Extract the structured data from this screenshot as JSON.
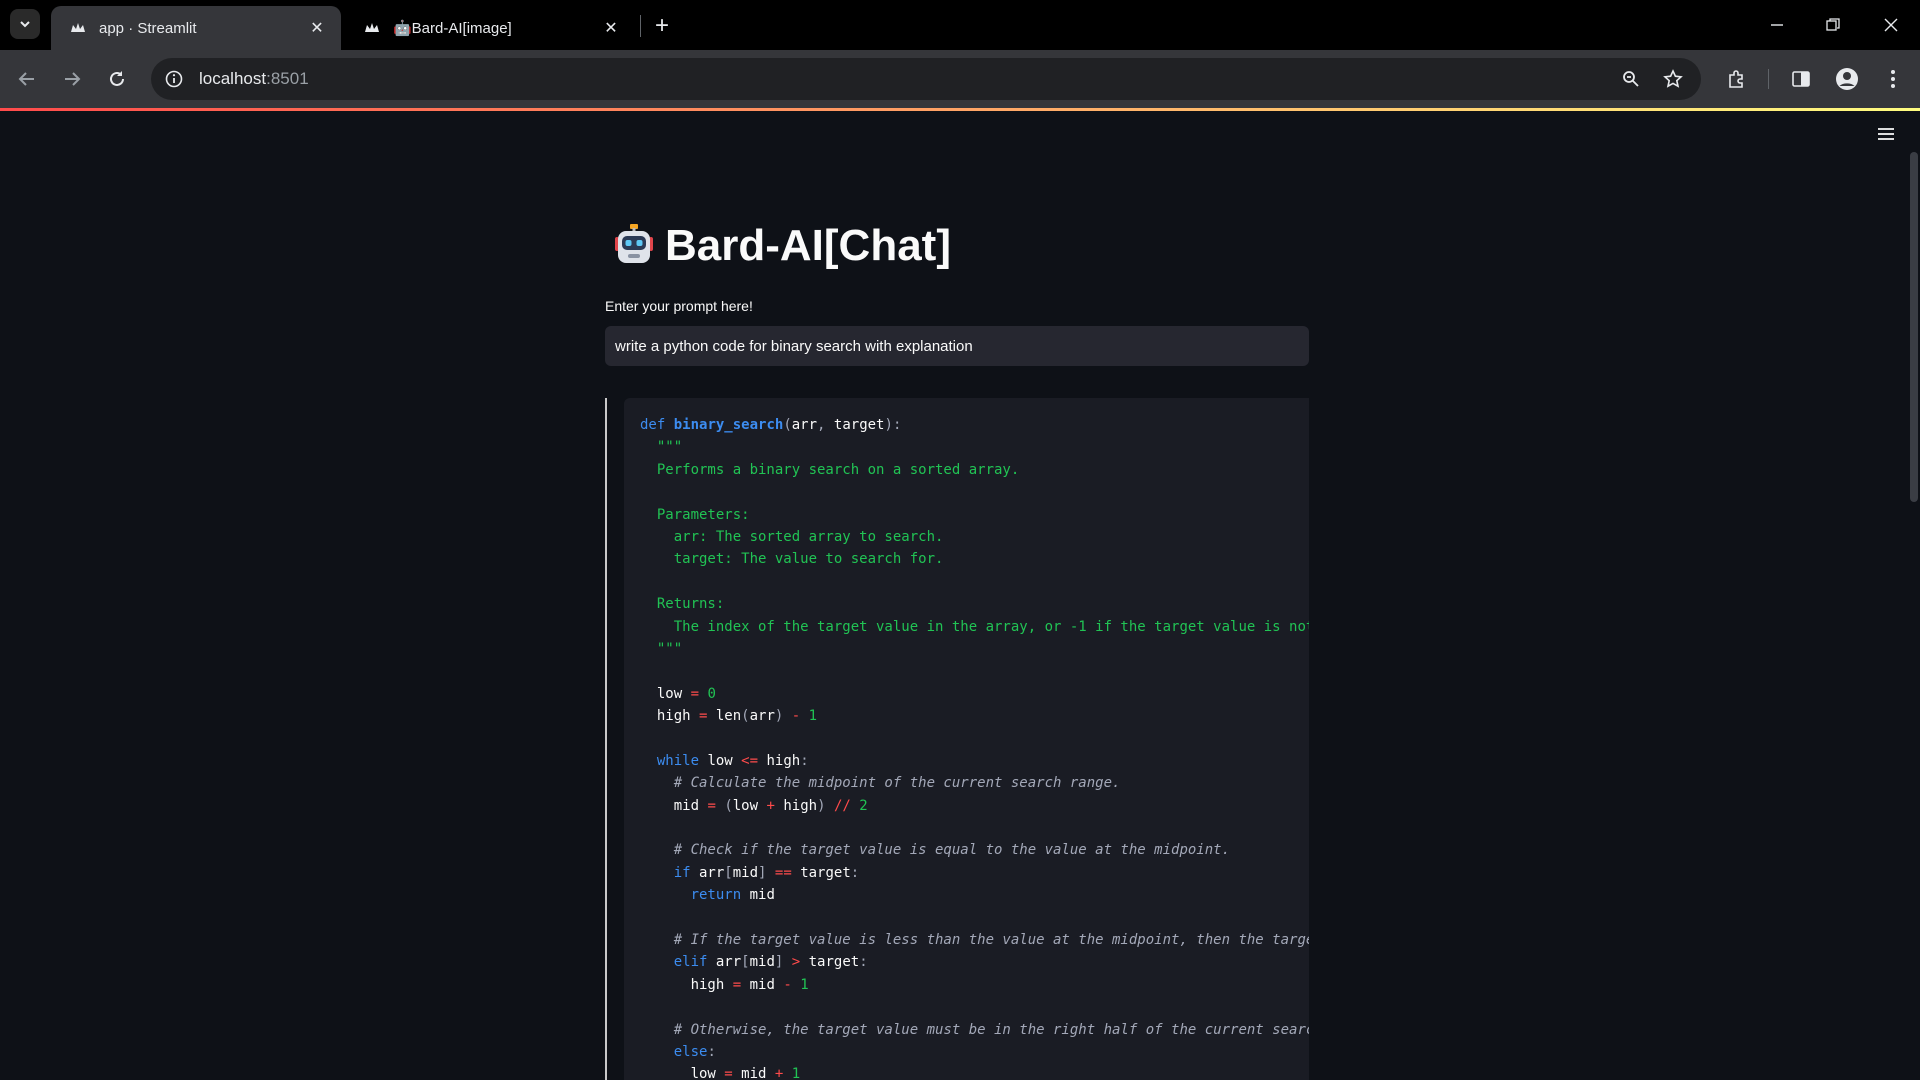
{
  "browser": {
    "tabs": [
      {
        "title": "app · Streamlit",
        "active": true,
        "favicon": "streamlit-crown-icon"
      },
      {
        "title": "🤖Bard-AI[image]",
        "active": false,
        "favicon": "streamlit-crown-icon"
      }
    ],
    "address": {
      "host": "localhost",
      "port": ":8501"
    }
  },
  "page": {
    "title": "Bard-AI[Chat]",
    "title_icon": "robot-icon",
    "prompt_label": "Enter your prompt here!",
    "prompt_value": "write a python code for binary search with explanation"
  },
  "code_lines": [
    "def binary_search(arr, target):",
    "  \"\"\"",
    "  Performs a binary search on a sorted array.",
    "",
    "  Parameters:",
    "    arr: The sorted array to search.",
    "    target: The value to search for.",
    "",
    "  Returns:",
    "    The index of the target value in the array, or -1 if the target value is not found.",
    "  \"\"\"",
    "",
    "  low = 0",
    "  high = len(arr) - 1",
    "",
    "  while low <= high:",
    "    # Calculate the midpoint of the current search range.",
    "    mid = (low + high) // 2",
    "",
    "    # Check if the target value is equal to the value at the midpoint.",
    "    if arr[mid] == target:",
    "      return mid",
    "",
    "    # If the target value is less than the value at the midpoint, then the target value must be in the left half.",
    "    elif arr[mid] > target:",
    "      high = mid - 1",
    "",
    "    # Otherwise, the target value must be in the right half of the current search range.",
    "    else:",
    "      low = mid + 1"
  ],
  "colors": {
    "background": "#0e1117",
    "input_bg": "#262730",
    "code_bg": "#1a1c24",
    "keyword": "#3c8cf0",
    "string": "#21c354",
    "operator": "#ff4b4b",
    "comment": "#a3a8b8"
  }
}
